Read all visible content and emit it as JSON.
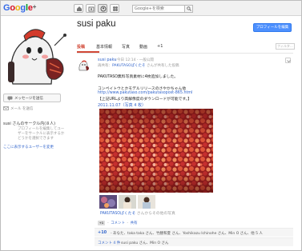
{
  "topbar": {
    "logo_text": "Google",
    "logo_plus": "+",
    "search_placeholder": "Google+を検索"
  },
  "sidebar": {
    "message_button": "メッセージを送信",
    "email_label": "メール を送信",
    "circles_title": "susi さんのサークル内(８人)",
    "circles_note": "プロフィールを編集してユーザーをサークルに表示するかどうかを選択できます",
    "show_link": "ここに表示するユーザーを変更"
  },
  "header": {
    "profile_name": "susi paku",
    "edit_button": "プロフィールを編集",
    "tabs": [
      "投稿",
      "基本情報",
      "写真",
      "動画",
      "+1"
    ],
    "small_search_placeholder": "フィルタ..."
  },
  "post": {
    "author": "susi paku",
    "meta": "- 今日 12:14 - 一般公開",
    "share_prefix": "再共有：",
    "share_source": "PAKUTASOぱくたそ",
    "share_suffix": "さんが共有した投稿",
    "lines": [
      "PAKUTASO無料写真素材に4枚追加しました。",
      "",
      "コンペイトウとかモデルリリースのさやかちゃん他",
      "http://www.pakutaso.com/pakutasopost-865.html",
      "【上記URLより高解像度のダウンロードが可能です。】"
    ],
    "album_title": "2011.11.07（写真 4 枚）",
    "album_footer_author": "PAKUTASOぱくたそ",
    "album_footer_text": "さんからその他の写真",
    "plusone_mini": "+1",
    "comment_link": "コメント",
    "share_link": "共有",
    "plus_count": "+10",
    "plus_names": "- あなた、taka taka さん、竹腰和夏 さん、Yoshikazu Ichinohe さん、Min O さん、他 5 人",
    "share_count": "コメント 4 件",
    "share_names": "- susi paku さん、Min O さん"
  },
  "colors": {
    "accent_red": "#d14836",
    "link_blue": "#3366cc",
    "button_blue": "#4d90fe"
  }
}
